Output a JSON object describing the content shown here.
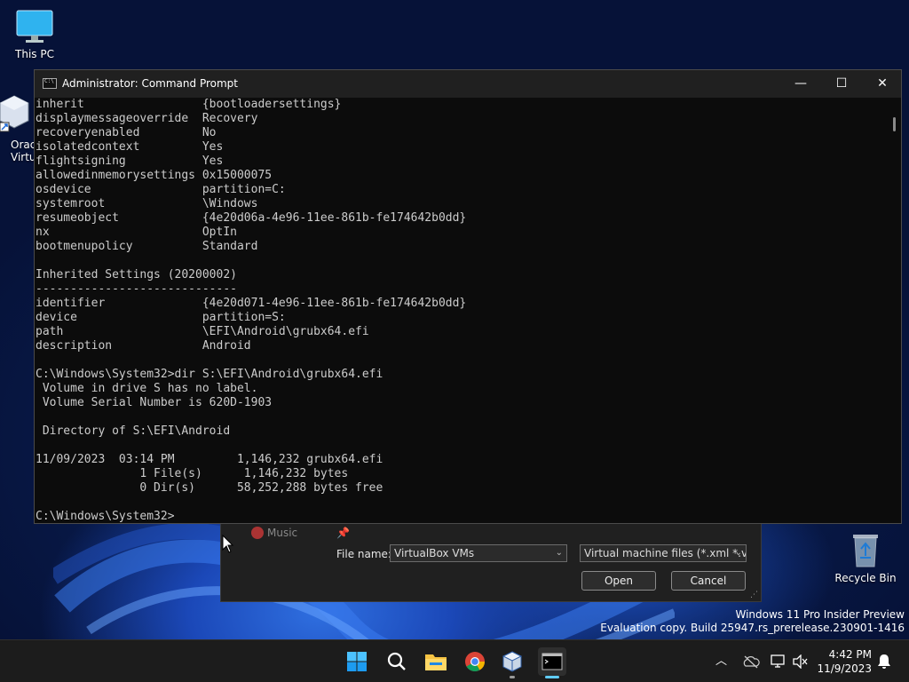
{
  "desktop": {
    "icons": [
      {
        "label": "This PC"
      },
      {
        "label": "Oracl\nVirtu"
      },
      {
        "label": "Recycle Bin"
      }
    ]
  },
  "cmd": {
    "title": "Administrator: Command Prompt",
    "controls": {
      "minimize": "—",
      "maximize": "☐",
      "close": "✕"
    },
    "output": "inherit                 {bootloadersettings}\ndisplaymessageoverride  Recovery\nrecoveryenabled         No\nisolatedcontext         Yes\nflightsigning           Yes\nallowedinmemorysettings 0x15000075\nosdevice                partition=C:\nsystemroot              \\Windows\nresumeobject            {4e20d06a-4e96-11ee-861b-fe174642b0dd}\nnx                      OptIn\nbootmenupolicy          Standard\n\nInherited Settings (20200002)\n-----------------------------\nidentifier              {4e20d071-4e96-11ee-861b-fe174642b0dd}\ndevice                  partition=S:\npath                    \\EFI\\Android\\grubx64.efi\ndescription             Android\n\nC:\\Windows\\System32>dir S:\\EFI\\Android\\grubx64.efi\n Volume in drive S has no label.\n Volume Serial Number is 620D-1903\n\n Directory of S:\\EFI\\Android\n\n11/09/2023  03:14 PM         1,146,232 grubx64.efi\n               1 File(s)      1,146,232 bytes\n               0 Dir(s)      58,252,288 bytes free\n\nC:\\Windows\\System32>"
  },
  "file_dialog": {
    "music_label": "Music",
    "file_name_label": "File name:",
    "file_name_value": "VirtualBox VMs",
    "filter_value": "Virtual machine files (*.xml *.vb",
    "open_label": "Open",
    "cancel_label": "Cancel"
  },
  "watermark": {
    "line1": "Windows 11 Pro Insider Preview",
    "line2": "Evaluation copy. Build 25947.rs_prerelease.230901-1416"
  },
  "taskbar": {
    "apps": [
      "start-icon",
      "search-icon",
      "file-explorer-icon",
      "chrome-icon",
      "virtualbox-icon",
      "terminal-icon"
    ],
    "clock": {
      "time": "4:42 PM",
      "date": "11/9/2023"
    }
  },
  "colors": {
    "terminal_bg": "#0c0c0c",
    "terminal_fg": "#cccccc",
    "accent": "#60cdff",
    "taskbar_bg": "#1c1c1c"
  }
}
